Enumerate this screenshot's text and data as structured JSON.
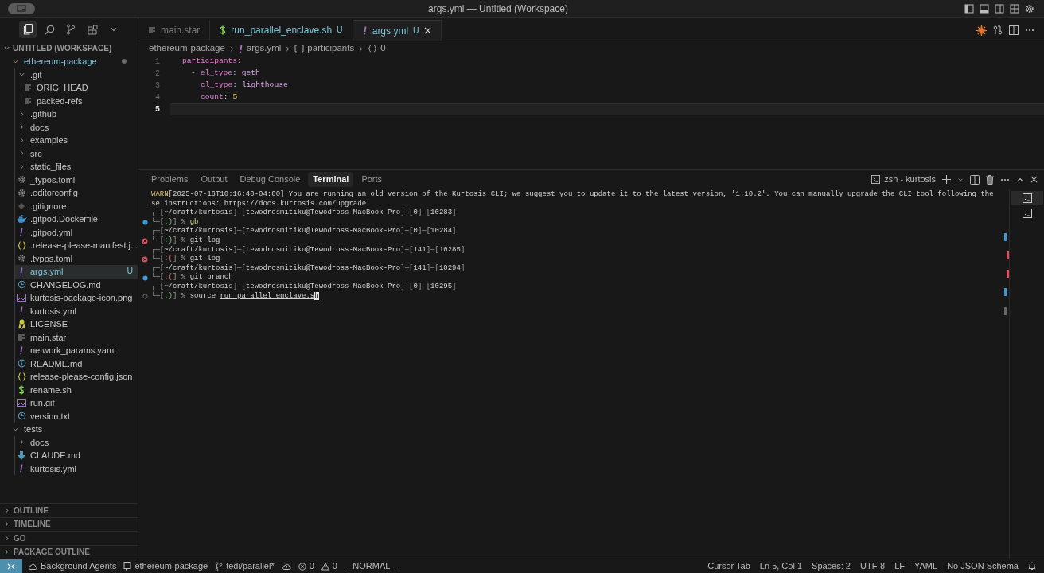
{
  "window": {
    "title": "args.yml — Untitled (Workspace)"
  },
  "activity": [
    {
      "selected": true
    },
    {
      "selected": false
    },
    {
      "selected": false
    },
    {
      "selected": false
    },
    {
      "selected": false
    }
  ],
  "explorer": {
    "header": "UNTITLED (WORKSPACE)",
    "tree": [
      {
        "label": "ethereum-package",
        "kind": "folder",
        "expanded": true,
        "dot": true,
        "children": [
          {
            "label": ".git",
            "kind": "folder",
            "expanded": true,
            "children": [
              {
                "label": "ORIG_HEAD",
                "kind": "plain"
              },
              {
                "label": "packed-refs",
                "kind": "plain"
              }
            ]
          },
          {
            "label": ".github",
            "kind": "folder",
            "expanded": false
          },
          {
            "label": "docs",
            "kind": "folder",
            "expanded": false
          },
          {
            "label": "examples",
            "kind": "folder",
            "expanded": false
          },
          {
            "label": "src",
            "kind": "folder",
            "expanded": false
          },
          {
            "label": "static_files",
            "kind": "folder",
            "expanded": false
          },
          {
            "label": "_typos.toml",
            "kind": "config"
          },
          {
            "label": ".editorconfig",
            "kind": "config"
          },
          {
            "label": ".gitignore",
            "kind": "ignore"
          },
          {
            "label": ".gitpod.Dockerfile",
            "kind": "docker"
          },
          {
            "label": ".gitpod.yml",
            "kind": "yaml"
          },
          {
            "label": ".release-please-manifest.j...",
            "kind": "json"
          },
          {
            "label": ".typos.toml",
            "kind": "config"
          },
          {
            "label": "args.yml",
            "kind": "yaml",
            "badge": "U",
            "selected": true
          },
          {
            "label": "CHANGELOG.md",
            "kind": "changelog"
          },
          {
            "label": "kurtosis-package-icon.png",
            "kind": "image"
          },
          {
            "label": "kurtosis.yml",
            "kind": "yaml"
          },
          {
            "label": "LICENSE",
            "kind": "license"
          },
          {
            "label": "main.star",
            "kind": "plain"
          },
          {
            "label": "network_params.yaml",
            "kind": "yaml"
          },
          {
            "label": "README.md",
            "kind": "readme"
          },
          {
            "label": "release-please-config.json",
            "kind": "json"
          },
          {
            "label": "rename.sh",
            "kind": "shell"
          },
          {
            "label": "run.gif",
            "kind": "image"
          },
          {
            "label": "version.txt",
            "kind": "changelog"
          }
        ]
      },
      {
        "label": "tests",
        "kind": "folder",
        "expanded": true,
        "children": [
          {
            "label": "docs",
            "kind": "folder",
            "expanded": false
          },
          {
            "label": "CLAUDE.md",
            "kind": "markdown"
          },
          {
            "label": "kurtosis.yml",
            "kind": "yaml"
          }
        ]
      }
    ]
  },
  "sections": [
    {
      "label": "OUTLINE",
      "expanded": false
    },
    {
      "label": "TIMELINE",
      "expanded": false
    },
    {
      "label": "GO",
      "expanded": false
    },
    {
      "label": "PACKAGE OUTLINE",
      "expanded": false
    }
  ],
  "editor_tabs": [
    {
      "label": "main.star",
      "kind": "plain",
      "selected": false
    },
    {
      "label": "run_parallel_enclave.sh",
      "kind": "shell",
      "badge": "U",
      "selected": false
    },
    {
      "label": "args.yml",
      "kind": "yaml",
      "badge": "U",
      "selected": true
    }
  ],
  "breadcrumb": [
    {
      "label": "ethereum-package",
      "kind": "folder"
    },
    {
      "label": "args.yml",
      "kind": "yaml"
    },
    {
      "label": "participants",
      "kind": "array"
    },
    {
      "label": "0",
      "kind": "object"
    }
  ],
  "code": [
    {
      "number": "1",
      "kind": "root",
      "current": false,
      "tokens": [
        {
          "text": "participants",
          "kind": "key"
        },
        {
          "text": ":",
          "kind": "punct"
        }
      ]
    },
    {
      "number": "2",
      "kind": "item_start",
      "current": false,
      "tokens": [
        {
          "text": "-",
          "kind": "punct"
        },
        {
          "text": "el_type",
          "kind": "key"
        },
        {
          "text": ":",
          "kind": "punct"
        },
        {
          "text": "geth",
          "kind": "str"
        }
      ]
    },
    {
      "number": "3",
      "kind": "item_field",
      "current": false,
      "tokens": [
        {
          "text": "cl_type",
          "kind": "key"
        },
        {
          "text": ":",
          "kind": "punct"
        },
        {
          "text": "lighthouse",
          "kind": "str"
        }
      ]
    },
    {
      "number": "4",
      "kind": "item_field",
      "current": false,
      "tokens": [
        {
          "text": "count",
          "kind": "key"
        },
        {
          "text": ":",
          "kind": "punct"
        },
        {
          "text": "5",
          "kind": "num"
        }
      ]
    },
    {
      "number": "5",
      "kind": "root",
      "current": true
    }
  ],
  "panel_tabs": [
    {
      "label": "Problems",
      "selected": false
    },
    {
      "label": "Output",
      "selected": false
    },
    {
      "label": "Debug Console",
      "selected": false
    },
    {
      "label": "Terminal",
      "selected": true
    },
    {
      "label": "Ports",
      "selected": false
    }
  ],
  "terminal_name": "zsh - kurtosis",
  "terminal": [
    {
      "segs": [
        {
          "text": "WARN",
          "kind": "warn"
        },
        {
          "text": "[2025-07-16T10:16:40-04:00] You are running an old version of the Kurtosis CLI; we suggest you to update it to the latest version, '1.10.2'. You can manually upgrade the CLI tool following the",
          "kind": "fg"
        }
      ]
    },
    {
      "segs": [
        {
          "text": "se instructions: https://docs.kurtosis.com/upgrade",
          "kind": "fg"
        }
      ]
    },
    {
      "segs": [
        {
          "text": "┌─[",
          "kind": "dim"
        },
        {
          "text": "~/craft/kurtosis",
          "kind": "fg"
        },
        {
          "text": "]─[",
          "kind": "dim"
        },
        {
          "text": "tewodrosmitiku@Tewodross-MacBook-Pro",
          "kind": "fg"
        },
        {
          "text": "]─[",
          "kind": "dim"
        },
        {
          "text": "0",
          "kind": "fg"
        },
        {
          "text": "]─[",
          "kind": "dim"
        },
        {
          "text": "10283",
          "kind": "fg"
        },
        {
          "text": "]",
          "kind": "dim"
        }
      ]
    },
    {
      "kind": "command_success",
      "segs": [
        {
          "text": "└─[",
          "kind": "dim"
        },
        {
          "text": ":)",
          "kind": "ok"
        },
        {
          "text": "] % ",
          "kind": "dim"
        },
        {
          "text": "gb",
          "kind": "cmd"
        }
      ]
    },
    {
      "segs": [
        {
          "text": "┌─[",
          "kind": "dim"
        },
        {
          "text": "~/craft/kurtosis",
          "kind": "fg"
        },
        {
          "text": "]─[",
          "kind": "dim"
        },
        {
          "text": "tewodrosmitiku@Tewodross-MacBook-Pro",
          "kind": "fg"
        },
        {
          "text": "]─[",
          "kind": "dim"
        },
        {
          "text": "0",
          "kind": "fg"
        },
        {
          "text": "]─[",
          "kind": "dim"
        },
        {
          "text": "10284",
          "kind": "fg"
        },
        {
          "text": "]",
          "kind": "dim"
        }
      ]
    },
    {
      "kind": "command_error",
      "segs": [
        {
          "text": "└─[",
          "kind": "dim"
        },
        {
          "text": ":)",
          "kind": "ok"
        },
        {
          "text": "] % ",
          "kind": "dim"
        },
        {
          "text": "git log",
          "kind": "fg"
        }
      ]
    },
    {
      "segs": [
        {
          "text": "┌─[",
          "kind": "dim"
        },
        {
          "text": "~/craft/kurtosis",
          "kind": "fg"
        },
        {
          "text": "]─[",
          "kind": "dim"
        },
        {
          "text": "tewodrosmitiku@Tewodross-MacBook-Pro",
          "kind": "fg"
        },
        {
          "text": "]─[",
          "kind": "dim"
        },
        {
          "text": "141",
          "kind": "fg"
        },
        {
          "text": "]─[",
          "kind": "dim"
        },
        {
          "text": "10285",
          "kind": "fg"
        },
        {
          "text": "]",
          "kind": "dim"
        }
      ]
    },
    {
      "kind": "command_error",
      "segs": [
        {
          "text": "└─[",
          "kind": "dim"
        },
        {
          "text": ":(",
          "kind": "bad"
        },
        {
          "text": "] % ",
          "kind": "dim"
        },
        {
          "text": "git log",
          "kind": "fg"
        }
      ]
    },
    {
      "segs": [
        {
          "text": "┌─[",
          "kind": "dim"
        },
        {
          "text": "~/craft/kurtosis",
          "kind": "fg"
        },
        {
          "text": "]─[",
          "kind": "dim"
        },
        {
          "text": "tewodrosmitiku@Tewodross-MacBook-Pro",
          "kind": "fg"
        },
        {
          "text": "]─[",
          "kind": "dim"
        },
        {
          "text": "141",
          "kind": "fg"
        },
        {
          "text": "]─[",
          "kind": "dim"
        },
        {
          "text": "10294",
          "kind": "fg"
        },
        {
          "text": "]",
          "kind": "dim"
        }
      ]
    },
    {
      "kind": "command_success",
      "segs": [
        {
          "text": "└─[",
          "kind": "dim"
        },
        {
          "text": ":(",
          "kind": "bad"
        },
        {
          "text": "] % ",
          "kind": "dim"
        },
        {
          "text": "git branch",
          "kind": "fg"
        }
      ]
    },
    {
      "segs": [
        {
          "text": "┌─[",
          "kind": "dim"
        },
        {
          "text": "~/craft/kurtosis",
          "kind": "fg"
        },
        {
          "text": "]─[",
          "kind": "dim"
        },
        {
          "text": "tewodrosmitiku@Tewodross-MacBook-Pro",
          "kind": "fg"
        },
        {
          "text": "]─[",
          "kind": "dim"
        },
        {
          "text": "0",
          "kind": "fg"
        },
        {
          "text": "]─[",
          "kind": "dim"
        },
        {
          "text": "10295",
          "kind": "fg"
        },
        {
          "text": "]",
          "kind": "dim"
        }
      ]
    },
    {
      "kind": "command_pending",
      "segs": [
        {
          "text": "└─[",
          "kind": "dim"
        },
        {
          "text": ":)",
          "kind": "ok"
        },
        {
          "text": "] % ",
          "kind": "dim"
        },
        {
          "text": "source ",
          "kind": "fg"
        },
        {
          "text": "run_parallel_enclave.s",
          "kind": "link"
        },
        {
          "text": "h",
          "kind": "cursor"
        }
      ]
    }
  ],
  "status_bar": {
    "left": [
      {
        "kind": "cloud",
        "label": "Background Agents"
      },
      {
        "kind": "repo",
        "label": "ethereum-package"
      },
      {
        "kind": "branch",
        "label": "tedi/parallel*"
      },
      {
        "kind": "sync"
      },
      {
        "kind": "error",
        "label": "0"
      },
      {
        "kind": "warning",
        "label": "0"
      },
      {
        "kind": "mode",
        "label": "-- NORMAL --"
      }
    ],
    "right": [
      "Cursor Tab",
      "Ln 5, Col 1",
      "Spaces: 2",
      "UTF-8",
      "LF",
      "YAML",
      "No JSON Schema"
    ]
  }
}
